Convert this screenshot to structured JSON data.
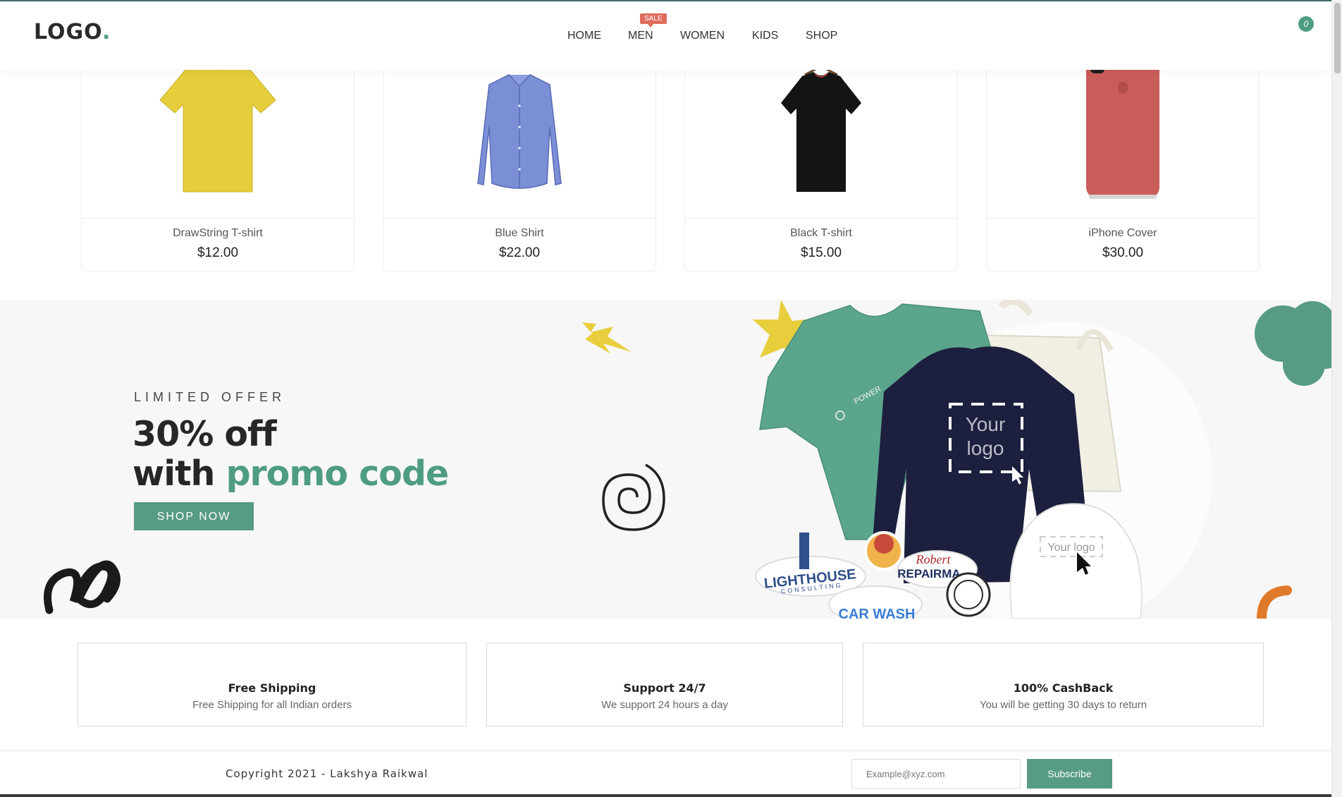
{
  "header": {
    "logo_text": "LOGO",
    "logo_dot": ".",
    "nav": [
      "HOME",
      "MEN",
      "WOMEN",
      "KIDS",
      "SHOP"
    ],
    "sale_badge": "SALE",
    "cart_count": "0"
  },
  "products": [
    {
      "name": "DrawString T-shirt",
      "price": "$12.00",
      "icon": "yellow-tshirt-image"
    },
    {
      "name": "Blue Shirt",
      "price": "$22.00",
      "icon": "blue-shirt-image"
    },
    {
      "name": "Black T-shirt",
      "price": "$15.00",
      "icon": "black-tshirt-image"
    },
    {
      "name": "iPhone Cover",
      "price": "$30.00",
      "icon": "iphone-cover-image"
    }
  ],
  "banner": {
    "kicker": "LIMITED OFFER",
    "line1": "30% off",
    "line2_prefix": "with ",
    "line2_highlight": "promo code",
    "cta": "SHOP NOW",
    "merch_texts": {
      "sweatshirt_logo_line1": "Your",
      "sweatshirt_logo_line2": "logo",
      "cap_logo": "Your logo",
      "tshirt_print": "POWER",
      "sticker_lighthouse": "LIGHTHOUSE",
      "sticker_consulting": "CONSULTING",
      "sticker_robert": "Robert",
      "sticker_repairman": "REPAIRMA",
      "sticker_carwash": "CAR WASH"
    }
  },
  "features": [
    {
      "title": "Free Shipping",
      "desc": "Free Shipping for all Indian orders"
    },
    {
      "title": "Support 24/7",
      "desc": "We support 24 hours a day"
    },
    {
      "title": "100% CashBack",
      "desc": "You will be getting 30 days to return"
    }
  ],
  "footer": {
    "copyright": "Copyright 2021 - Lakshya Raikwal",
    "email_placeholder": "Example@xyz.com",
    "subscribe": "Subscribe"
  },
  "colors": {
    "accent": "#579b84",
    "sale": "#e06c5c",
    "yellow": "#e8ce3d",
    "orange": "#e07a2b"
  }
}
